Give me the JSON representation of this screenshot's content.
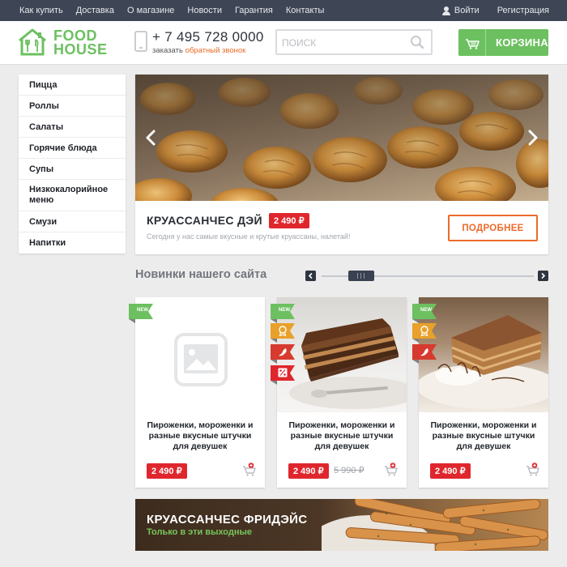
{
  "topnav": {
    "links": [
      "Как купить",
      "Доставка",
      "О магазине",
      "Новости",
      "Гарантия",
      "Контакты"
    ],
    "login": "Войти",
    "register": "Регистрация"
  },
  "header": {
    "logo_line1": "FOOD",
    "logo_line2": "HOUSE",
    "phone": "+ 7 495 728 0000",
    "callback_prefix": "заказать",
    "callback_link": "обратный звонок",
    "search_placeholder": "ПОИСК",
    "cart_label": "КОРЗИНА"
  },
  "sidebar": {
    "items": [
      "Пицца",
      "Роллы",
      "Салаты",
      "Горячие блюда",
      "Супы",
      "Низкокалорийное меню",
      "Смузи",
      "Напитки"
    ]
  },
  "slider": {
    "title": "КРУАССАНЧЕС ДЭЙ",
    "price": "2 490 ₽",
    "description": "Сегодня у нас самые вкусные и крутые круассаны, налетай!",
    "button": "ПОДРОБНЕЕ"
  },
  "new_section": {
    "title": "Новинки нашего сайта"
  },
  "products": [
    {
      "name": "Пироженки, мороженки и разные вкусные штучки для девушек",
      "price": "2 490 ₽",
      "old_price": "",
      "badge": "NEW",
      "image": "placeholder-image-icon"
    },
    {
      "name": "Пироженки, мороженки и разные вкусные штучки для девушек",
      "price": "2 490 ₽",
      "old_price": "5 990 ₽",
      "badge": "NEW",
      "image": "cake-photo"
    },
    {
      "name": "Пироженки, мороженки и разные вкусные штучки для девушек",
      "price": "2 490 ₽",
      "old_price": "",
      "badge": "NEW",
      "image": "cake-photo"
    }
  ],
  "promo": {
    "title": "КРУАССАНЧЕС ФРИДЭЙС",
    "subtitle": "Только в эти выходные"
  },
  "colors": {
    "green": "#6cc060",
    "red": "#e0262d",
    "orange": "#ec6b2b",
    "nav_bg": "#3e4655"
  }
}
